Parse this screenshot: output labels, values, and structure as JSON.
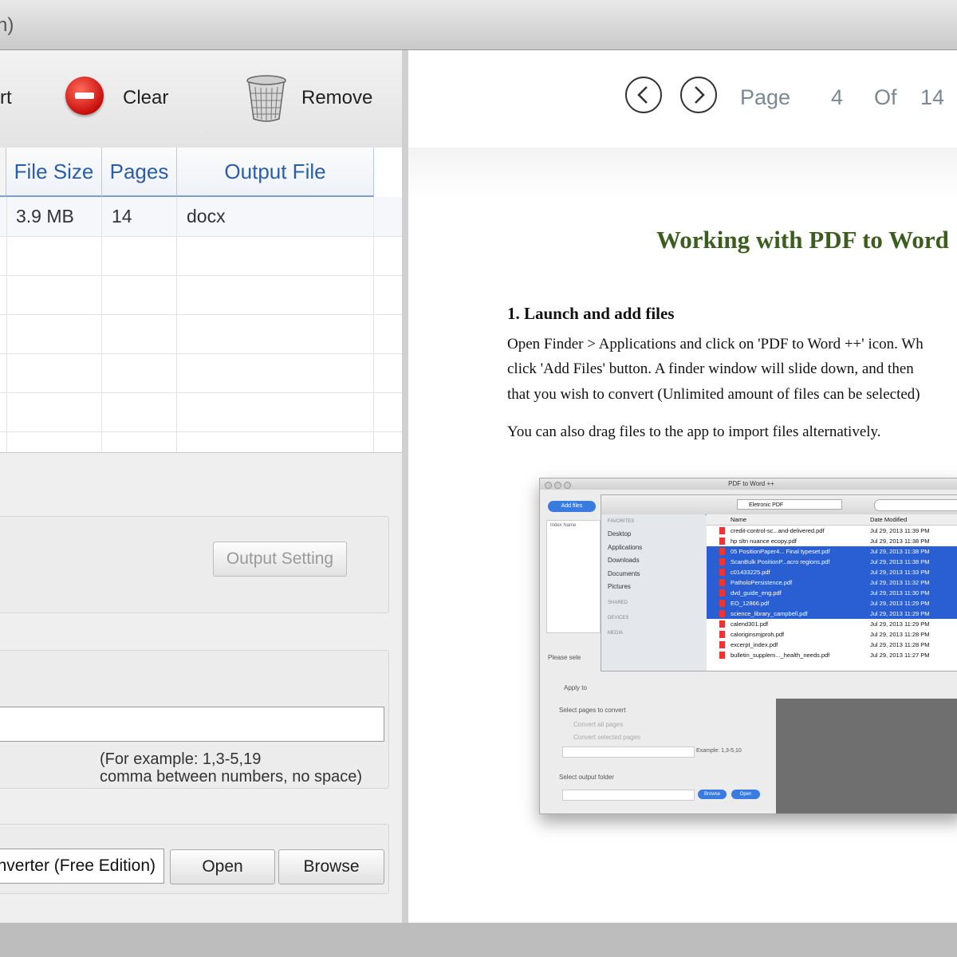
{
  "window": {
    "title_fragment": "n)"
  },
  "toolbar": {
    "partial_label": "rt",
    "clear_label": "Clear",
    "remove_label": "Remove"
  },
  "table": {
    "columns": [
      "File Size",
      "Pages",
      "Output File"
    ],
    "rows": [
      {
        "file_size": "3.9 MB",
        "pages": "14",
        "output_file": "docx"
      }
    ]
  },
  "settings": {
    "output_setting_label": "Output Setting"
  },
  "page_range": {
    "hint_line1": "(For example: 1,3-5,19",
    "hint_line2": "comma between numbers, no space)"
  },
  "output_folder": {
    "path": "nverter (Free Edition)",
    "open_label": "Open",
    "browse_label": "Browse"
  },
  "viewer": {
    "page_label": "Page",
    "current_page": "4",
    "of_label": "Of",
    "total_pages": "14"
  },
  "document": {
    "title": "Working with PDF to Word",
    "heading": "1. Launch and add files",
    "lines": [
      "Open Finder > Applications and click on 'PDF to Word ++' icon. Wh",
      "click 'Add Files' button. A finder window will slide down, and then",
      "that you wish to convert (Unlimited amount of files can be selected)",
      "You can also drag files to the app to import files alternatively."
    ]
  },
  "embedded_screenshot": {
    "title": "PDF to Word ++",
    "add_files": "Add files",
    "panel_header": "Index   Name",
    "location": "Eletronic PDF",
    "sidebar": {
      "favorites": "FAVORITES",
      "items": [
        "Desktop",
        "Applications",
        "Downloads",
        "Documents",
        "Pictures"
      ],
      "shared": "SHARED",
      "devices": "DEVICES",
      "media": "MEDIA"
    },
    "columns": {
      "name": "Name",
      "date": "Date Modified"
    },
    "files": [
      {
        "name": "credit-control-sc...and-delivered.pdf",
        "date": "Jul 29, 2013 11:39 PM",
        "selected": false
      },
      {
        "name": "hp sltn nuance ecopy.pdf",
        "date": "Jul 29, 2013 11:38 PM",
        "selected": false
      },
      {
        "name": "05 PositionPaper4... Final typeset.pdf",
        "date": "Jul 29, 2013 11:38 PM",
        "selected": true
      },
      {
        "name": "ScanBulk PositionP...acro regions.pdf",
        "date": "Jul 29, 2013 11:38 PM",
        "selected": true
      },
      {
        "name": "c01433225.pdf",
        "date": "Jul 29, 2013 11:33 PM",
        "selected": true
      },
      {
        "name": "PatholoPersistence.pdf",
        "date": "Jul 29, 2013 11:32 PM",
        "selected": true
      },
      {
        "name": "dvd_guide_eng.pdf",
        "date": "Jul 29, 2013 11:30 PM",
        "selected": true
      },
      {
        "name": "EO_12866.pdf",
        "date": "Jul 29, 2013 11:29 PM",
        "selected": true
      },
      {
        "name": "science_library_campbell.pdf",
        "date": "Jul 29, 2013 11:29 PM",
        "selected": true
      },
      {
        "name": "calend301.pdf",
        "date": "Jul 29, 2013 11:29 PM",
        "selected": false
      },
      {
        "name": "caloriginsmjproh.pdf",
        "date": "Jul 29, 2013 11:28 PM",
        "selected": false
      },
      {
        "name": "excerpt_index.pdf",
        "date": "Jul 29, 2013 11:28 PM",
        "selected": false
      },
      {
        "name": "bulletin_supplem..._health_needs.pdf",
        "date": "Jul 29, 2013 11:27 PM",
        "selected": false
      }
    ],
    "please_select": "Please sele",
    "apply": "Apply to",
    "select_pages": "Select pages to convert",
    "convert_all": "Convert all pages",
    "convert_selected": "Convert selected pages",
    "example": "Example: 1,3-5,10",
    "select_output": "Select output folder",
    "browse": "Browse",
    "open": "Open"
  }
}
